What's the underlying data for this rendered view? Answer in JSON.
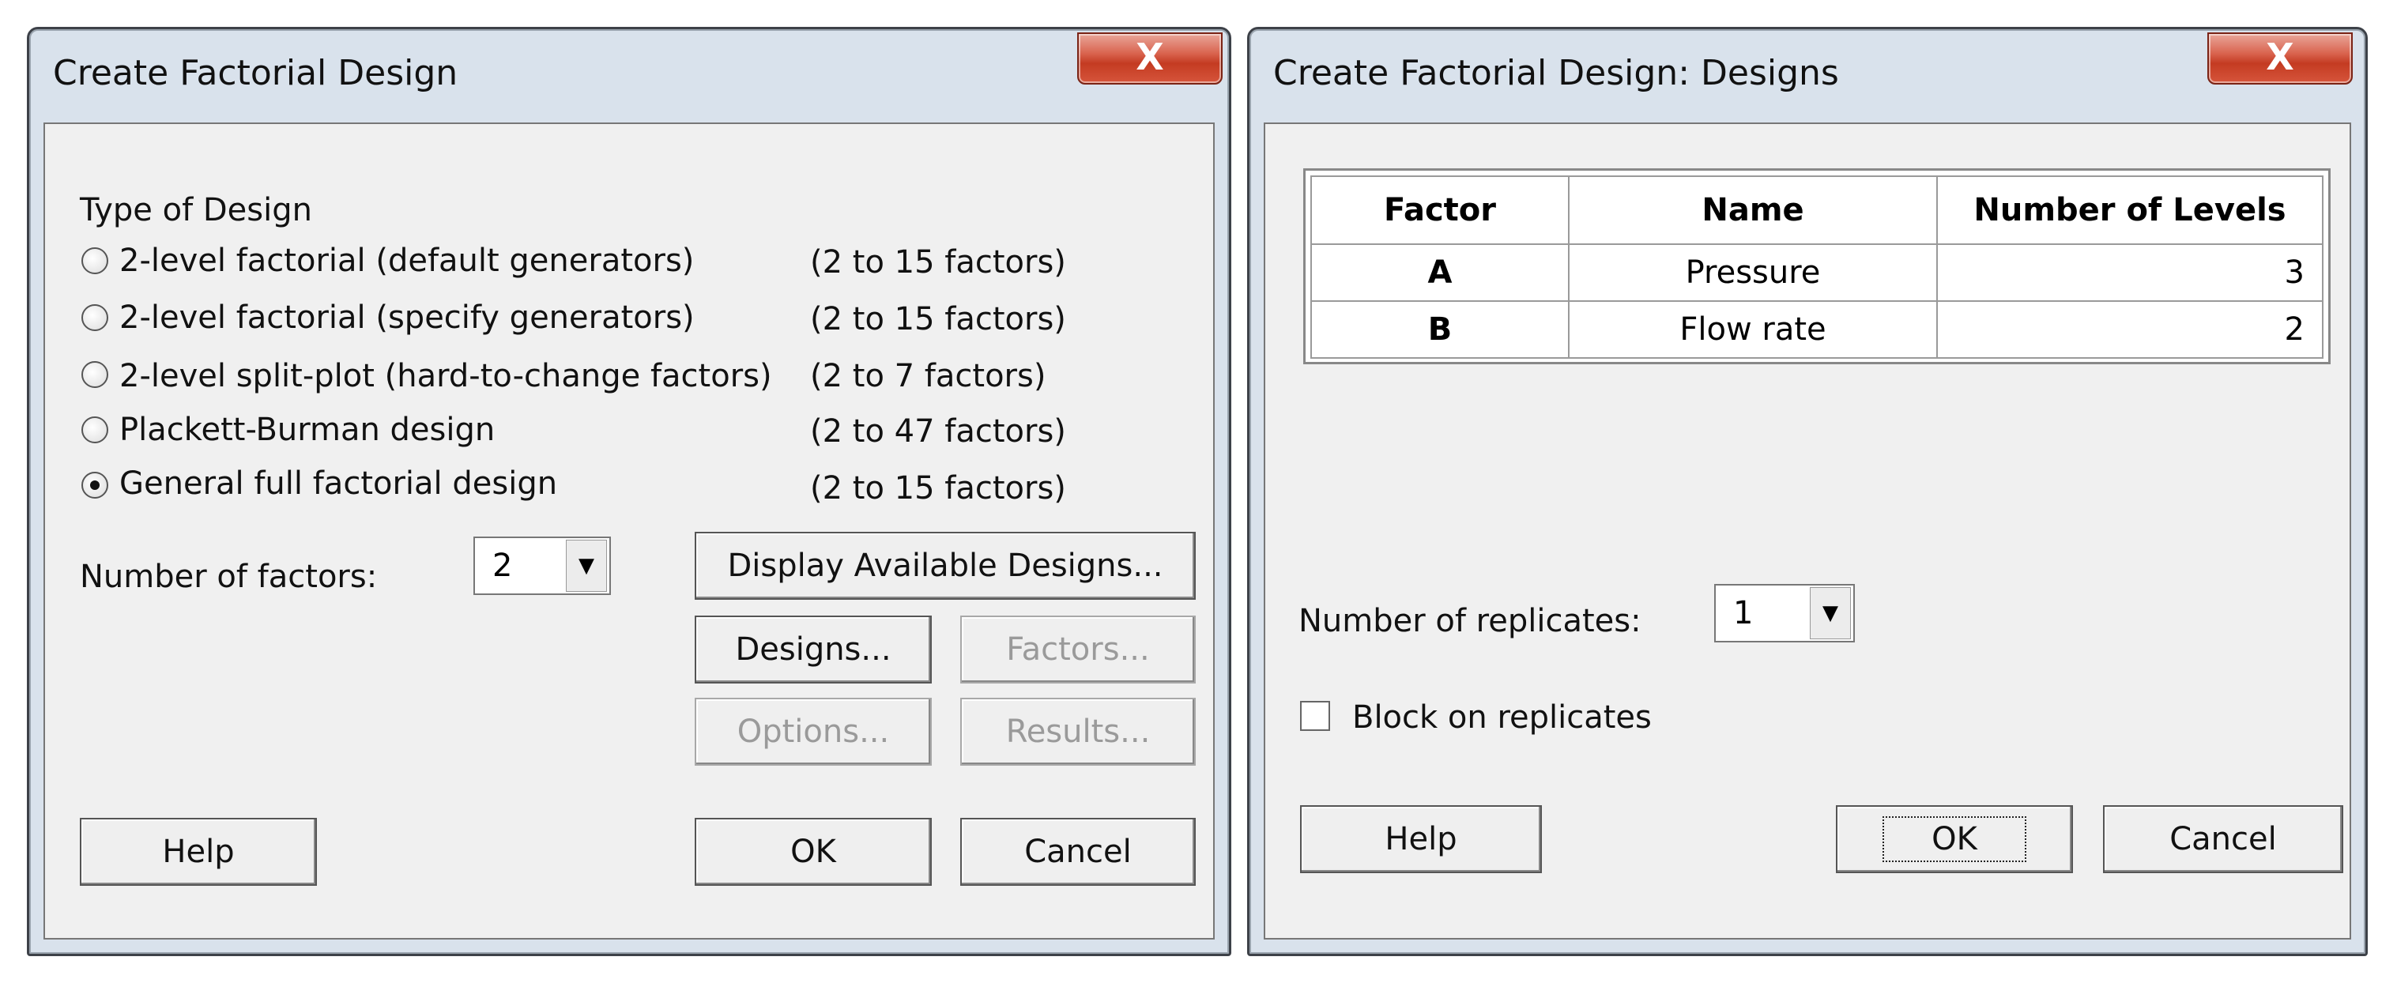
{
  "dialog1": {
    "title": "Create Factorial Design",
    "close_glyph": "X",
    "type_of_design_label": "Type of Design",
    "options": [
      {
        "label": "2-level factorial (default generators)",
        "range": "(2 to 15 factors)",
        "selected": false
      },
      {
        "label": "2-level factorial (specify generators)",
        "range": "(2 to 15 factors)",
        "selected": false
      },
      {
        "label": "2-level split-plot (hard-to-change factors)",
        "range": "(2 to 7 factors)",
        "selected": false
      },
      {
        "label": "Plackett-Burman design",
        "range": "(2 to 47 factors)",
        "selected": false
      },
      {
        "label": "General full factorial design",
        "range": "(2 to 15 factors)",
        "selected": true
      }
    ],
    "num_factors_label": "Number of factors:",
    "num_factors_value": "2",
    "display_designs_button": "Display Available Designs...",
    "designs_button": "Designs...",
    "factors_button": "Factors...",
    "options_button": "Options...",
    "results_button": "Results...",
    "help_button": "Help",
    "ok_button": "OK",
    "cancel_button": "Cancel"
  },
  "dialog2": {
    "title": "Create Factorial Design: Designs",
    "close_glyph": "X",
    "table": {
      "headers": [
        "Factor",
        "Name",
        "Number of Levels"
      ],
      "rows": [
        {
          "factor": "A",
          "name": "Pressure",
          "levels": "3"
        },
        {
          "factor": "B",
          "name": "Flow rate",
          "levels": "2"
        }
      ]
    },
    "replicates_label": "Number of replicates:",
    "replicates_value": "1",
    "block_label": "Block on replicates",
    "block_checked": false,
    "help_button": "Help",
    "ok_button": "OK",
    "cancel_button": "Cancel"
  },
  "colors": {
    "frame": "#d9e2ec",
    "client": "#f0f0f0",
    "close_button": "#c43b22"
  },
  "icons": {
    "close": "close-icon",
    "dropdown": "chevron-down-icon"
  }
}
